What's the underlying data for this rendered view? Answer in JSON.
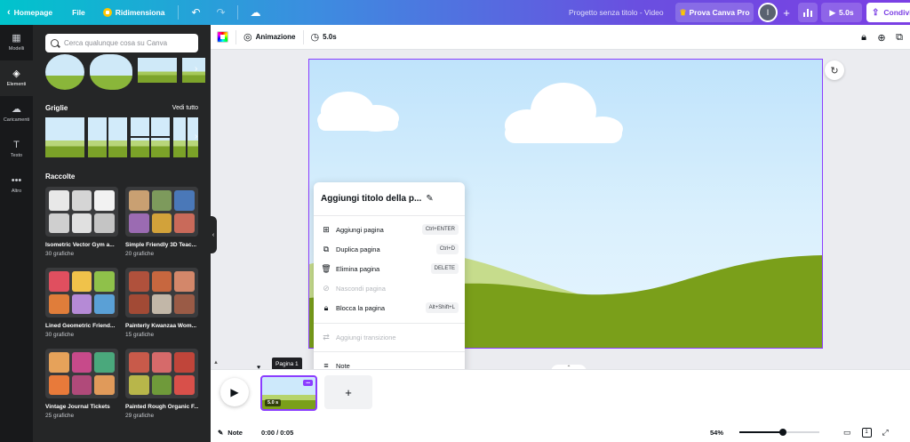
{
  "topbar": {
    "home_label": "Homepage",
    "file_label": "File",
    "resize_label": "Ridimensiona",
    "project_title": "Progetto senza titolo - Video",
    "pro_label": "Prova Canva Pro",
    "avatar_initial": "I",
    "play_duration": "5.0s",
    "share_label": "Condividi"
  },
  "rail": {
    "items": [
      {
        "label": "Modelli",
        "icon": "layout-icon"
      },
      {
        "label": "Elementi",
        "icon": "shapes-icon"
      },
      {
        "label": "Caricamenti",
        "icon": "upload-cloud-icon"
      },
      {
        "label": "Testo",
        "icon": "text-icon"
      },
      {
        "label": "Altro",
        "icon": "more-icon"
      }
    ],
    "active": "Elementi"
  },
  "panel": {
    "search_placeholder": "Cerca qualunque cosa su Canva",
    "grids_title": "Griglie",
    "grids_link": "Vedi tutto",
    "collections_title": "Raccolte",
    "collections": [
      {
        "name": "Isometric Vector Gym a...",
        "count": "30 grafiche"
      },
      {
        "name": "Simple Friendly 3D Teac...",
        "count": "20 grafiche"
      },
      {
        "name": "Lined Geometric Friend...",
        "count": "30 grafiche"
      },
      {
        "name": "Painterly Kwanzaa Wom...",
        "count": "15 grafiche"
      },
      {
        "name": "Vintage Journal Tickets",
        "count": "25 grafiche"
      },
      {
        "name": "Painted Rough Organic F...",
        "count": "29 grafiche"
      }
    ]
  },
  "toolbar": {
    "animation_label": "Animazione",
    "duration_label": "5.0s"
  },
  "context_menu": {
    "title": "Aggiungi titolo della p...",
    "items": [
      {
        "label": "Aggiungi pagina",
        "shortcut": "Ctrl+ENTER",
        "icon": "add-page-icon",
        "disabled": false
      },
      {
        "label": "Duplica pagina",
        "shortcut": "Ctrl+D",
        "icon": "duplicate-icon",
        "disabled": false
      },
      {
        "label": "Elimina pagina",
        "shortcut": "DELETE",
        "icon": "trash-icon",
        "disabled": false
      },
      {
        "label": "Nascondi pagina",
        "shortcut": "",
        "icon": "eye-off-icon",
        "disabled": true
      },
      {
        "label": "Blocca la pagina",
        "shortcut": "Alt+Shift+L",
        "icon": "lock-icon",
        "disabled": false
      },
      {
        "label": "Aggiungi transizione",
        "shortcut": "",
        "icon": "transition-icon",
        "disabled": true
      },
      {
        "label": "Note",
        "shortcut": "",
        "icon": "notes-icon",
        "disabled": false
      }
    ]
  },
  "timeline": {
    "tooltip": "Pagina 1",
    "thumb_duration": "5.0 s"
  },
  "footer": {
    "notes_label": "Note",
    "time": "0:00 / 0:05",
    "zoom": "54%",
    "zoom_fraction": 0.54,
    "page_number": "1"
  },
  "colors": {
    "accent": "#8b3dff",
    "sky": "#bfe3fb",
    "grass_dark": "#7a9f1a",
    "grass_light": "#c6dc8c"
  }
}
